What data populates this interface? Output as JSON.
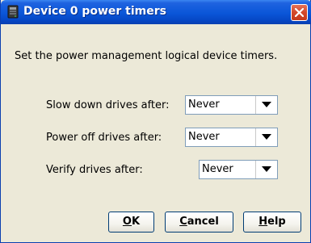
{
  "window": {
    "title": "Device 0 power timers",
    "description": "Set the power management logical device timers."
  },
  "fields": [
    {
      "label": "Slow down drives after:",
      "value": "Never"
    },
    {
      "label": "Power off drives after:",
      "value": "Never"
    },
    {
      "label": "Verify drives after:",
      "value": "Never"
    }
  ],
  "buttons": {
    "ok": {
      "mnemonic": "O",
      "rest": "K"
    },
    "cancel": {
      "mnemonic": "C",
      "rest": "ancel"
    },
    "help": {
      "mnemonic": "H",
      "rest": "elp"
    }
  },
  "colors": {
    "titlebar": "#0a56d8",
    "dialog_bg": "#ece9d8",
    "close_button": "#d2482a"
  },
  "icons": {
    "title": "device-icon",
    "close": "close-icon",
    "dropdown": "chevron-down-icon"
  }
}
